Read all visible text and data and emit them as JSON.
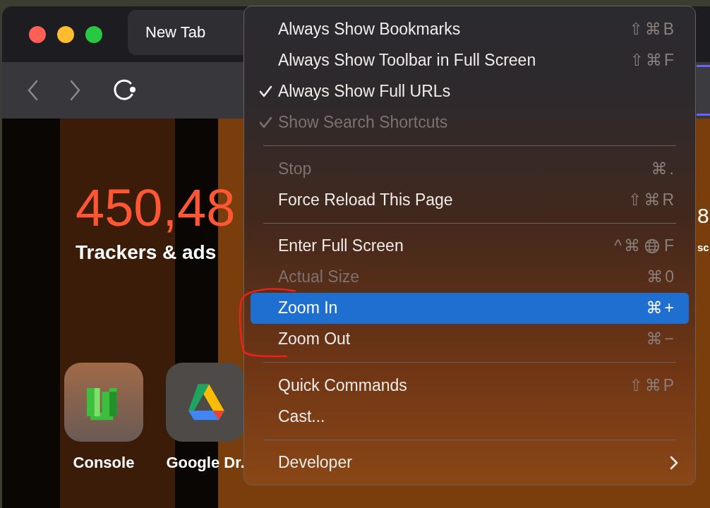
{
  "tabs": [
    {
      "label": "New Tab",
      "selected": true
    }
  ],
  "new_tab_page": {
    "stat": {
      "value": "450,48",
      "caption": "Trackers & ads"
    },
    "right_stat": {
      "value": "8",
      "caption": "sc"
    },
    "tiles": [
      {
        "kind": "console",
        "label": "Console"
      },
      {
        "kind": "drive",
        "label": "Google Dr."
      }
    ]
  },
  "menu": {
    "items": [
      {
        "kind": "item",
        "label": "Always Show Bookmarks",
        "shortcut": "⇧⌘B",
        "checked": false,
        "disabled": false,
        "selected": false
      },
      {
        "kind": "item",
        "label": "Always Show Toolbar in Full Screen",
        "shortcut": "⇧⌘F",
        "checked": false,
        "disabled": false,
        "selected": false
      },
      {
        "kind": "item",
        "label": "Always Show Full URLs",
        "checked": true,
        "disabled": false,
        "selected": false
      },
      {
        "kind": "item",
        "label": "Show Search Shortcuts",
        "checked": true,
        "disabled": true,
        "selected": false
      },
      {
        "kind": "separator"
      },
      {
        "kind": "item",
        "label": "Stop",
        "shortcut": "⌘.",
        "checked": false,
        "disabled": true,
        "selected": false
      },
      {
        "kind": "item",
        "label": "Force Reload This Page",
        "shortcut": "⇧⌘R",
        "checked": false,
        "disabled": false,
        "selected": false
      },
      {
        "kind": "separator"
      },
      {
        "kind": "item",
        "label": "Enter Full Screen",
        "shortcut_parts": [
          {
            "kind": "text",
            "text": "^⌘"
          },
          {
            "kind": "globe"
          },
          {
            "kind": "text",
            "text": "F"
          }
        ],
        "checked": false,
        "disabled": false,
        "selected": false
      },
      {
        "kind": "item",
        "label": "Actual Size",
        "shortcut": "⌘0",
        "checked": false,
        "disabled": true,
        "selected": false
      },
      {
        "kind": "item",
        "label": "Zoom In",
        "shortcut": "⌘+",
        "checked": false,
        "disabled": false,
        "selected": true
      },
      {
        "kind": "item",
        "label": "Zoom Out",
        "shortcut": "⌘−",
        "checked": false,
        "disabled": false,
        "selected": false
      },
      {
        "kind": "separator"
      },
      {
        "kind": "item",
        "label": "Quick Commands",
        "shortcut": "⇧⌘P",
        "checked": false,
        "disabled": false,
        "selected": false
      },
      {
        "kind": "item",
        "label": "Cast...",
        "checked": false,
        "disabled": false,
        "selected": false
      },
      {
        "kind": "separator"
      },
      {
        "kind": "item",
        "label": "Developer",
        "submenu": true,
        "checked": false,
        "disabled": false,
        "selected": false
      }
    ]
  }
}
